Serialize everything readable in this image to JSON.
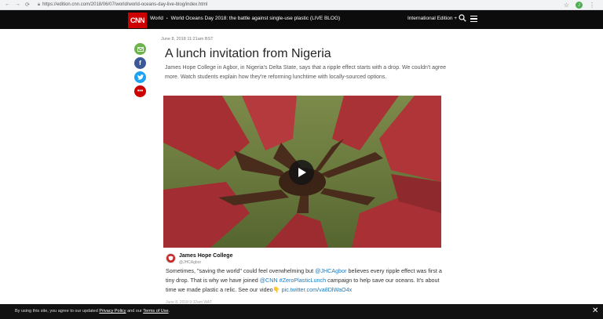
{
  "browser": {
    "url": "https://edition.cnn.com/2018/06/07/world/world-oceans-day-live-blog/index.html",
    "extension_initial": "J"
  },
  "header": {
    "logo_text": "CNN",
    "section": "World",
    "blog_title": "World Oceans Day 2018: the battle against single-use plastic (LIVE BLOG)",
    "edition": "International Edition +"
  },
  "post": {
    "timestamp": "June 8, 2018 11:21am BST",
    "title": "A lunch invitation from Nigeria",
    "intro": "James Hope College in Agbor, in Nigeria's Delta State, says that a ripple effect starts with a drop. We couldn't agree more. Watch students explain how they're reforming lunchtime with locally-sourced options."
  },
  "tweet": {
    "name": "James Hope College",
    "handle": "@JHCAgbor",
    "text_1": "Sometimes, \"saving the world\" could feel overwhelming but ",
    "mention_1": "@JHCAgbor",
    "text_2": " believes every ripple effect was first a tiny drop. That is why we have joined ",
    "mention_2": "@CNN",
    "text_3": " ",
    "hashtag": "#ZeroPlasticLunch",
    "text_4": " campaign to help save our oceans. It's about time we made plastic a relic. See our video",
    "emoji": "👇",
    "link": "pic.twitter.com/va8DlWaO4x",
    "footer": "June 8, 2018 9:32am WAT"
  },
  "cookie": {
    "text_before": "By using this site, you agree to our updated ",
    "privacy_link": "Privacy Policy",
    "text_mid": " and our ",
    "terms_link": "Terms of Use",
    "text_after": "."
  },
  "colors": {
    "cnn_red": "#cc0000",
    "header_bg": "#0c0c0c",
    "link_blue": "#1b7bbf"
  }
}
